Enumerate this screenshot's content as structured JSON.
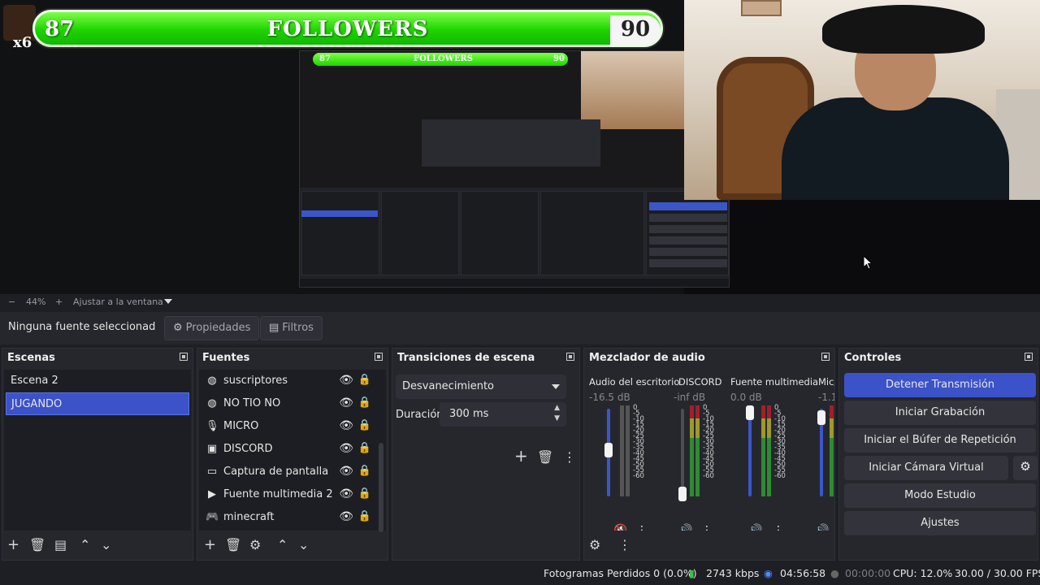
{
  "overlay": {
    "left_count": "87",
    "title": "FOLLOWERS",
    "right_count": "90",
    "badge": "x6"
  },
  "nested_overlay": {
    "left_count": "87",
    "title": "FOLLOWERS",
    "right_count": "90"
  },
  "zoom": {
    "minus": "−",
    "value": "44%",
    "plus": "+",
    "fit_label": "Ajustar a la ventana"
  },
  "source_toolbar": {
    "no_source": "Ninguna fuente seleccionad",
    "properties": "Propiedades",
    "filters": "Filtros"
  },
  "scenes": {
    "title": "Escenas",
    "items": [
      {
        "label": "Escena 2",
        "active": false
      },
      {
        "label": "JUGANDO",
        "active": true
      }
    ]
  },
  "sources": {
    "title": "Fuentes",
    "items": [
      {
        "label": "suscriptores",
        "icon": "browser-icon"
      },
      {
        "label": "NO TIO NO",
        "icon": "browser-icon"
      },
      {
        "label": "MICRO",
        "icon": "microphone-icon"
      },
      {
        "label": "DISCORD",
        "icon": "window-capture-icon"
      },
      {
        "label": "Captura de pantalla",
        "icon": "display-capture-icon"
      },
      {
        "label": "Fuente multimedia 2",
        "icon": "media-play-icon"
      },
      {
        "label": "minecraft",
        "icon": "gamepad-icon"
      }
    ]
  },
  "transitions": {
    "title": "Transiciones de escena",
    "selected": "Desvanecimiento",
    "duration_label": "Duración",
    "duration_value": "300 ms"
  },
  "mixer": {
    "title": "Mezclador de audio",
    "channels": [
      {
        "name": "Audio del escritorio",
        "db": "-16.5 dB",
        "muted": true
      },
      {
        "name": "DISCORD",
        "db": "-inf dB",
        "muted": false
      },
      {
        "name": "Fuente multimedia",
        "db": "0.0 dB",
        "muted": false
      },
      {
        "name": "Mic/",
        "db": "-1.1",
        "muted": false
      }
    ],
    "scale": [
      "0",
      "-5",
      "-10",
      "-15",
      "-20",
      "-25",
      "-30",
      "-35",
      "-40",
      "-45",
      "-50",
      "-55",
      "-60"
    ]
  },
  "controls": {
    "title": "Controles",
    "stop_stream": "Detener Transmisión",
    "start_recording": "Iniciar Grabación",
    "start_replay": "Iniciar el Búfer de Repetición",
    "start_virtualcam": "Iniciar Cámara Virtual",
    "studio_mode": "Modo Estudio",
    "settings": "Ajustes"
  },
  "status": {
    "dropped_frames": "Fotogramas Perdidos 0 (0.0%)",
    "bitrate": "2743 kbps",
    "stream_time": "04:56:58",
    "rec_time": "00:00:00",
    "cpu": "CPU: 12.0%",
    "fps": "30.00 / 30.00 FPS"
  },
  "colors": {
    "accent": "#3b52c9",
    "overlay_green": "#1fd400",
    "meter_green": "#2f8a34",
    "meter_red": "#a21f2a"
  }
}
